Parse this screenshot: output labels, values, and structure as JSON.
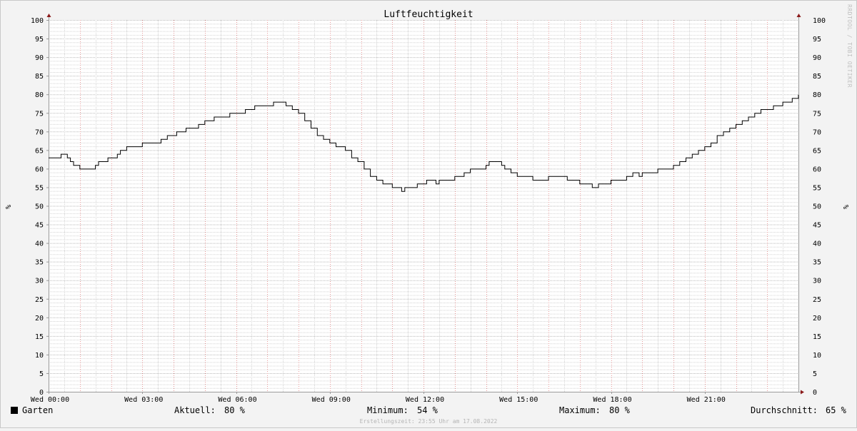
{
  "watermark": "RRDTOOL / TOBI OETIKER",
  "footer": "Erstellungszeit: 23:55 Uhr am 17.08.2022",
  "colors": {
    "background": "#f3f3f3",
    "canvas": "#ffffff",
    "minor_grid": "#d4d4d4",
    "major_grid": "#e89a9a",
    "axis": "#9a9a9a",
    "arrow": "#8b1a1a",
    "series": "#000000"
  },
  "legend": {
    "series_name": "Garten",
    "aktuell_label": "Aktuell:",
    "aktuell_value": "80 %",
    "minimum_label": "Minimum:",
    "minimum_value": "54 %",
    "maximum_label": "Maximum:",
    "maximum_value": "80 %",
    "durchschnitt_label": "Durchschnitt:",
    "durchschnitt_value": "65 %"
  },
  "chart_data": {
    "type": "line",
    "title": "Luftfeuchtigkeit",
    "ylabel": "%",
    "ylabel_right": "%",
    "ylim": [
      0,
      100
    ],
    "y_ticks": [
      0,
      5,
      10,
      15,
      20,
      25,
      30,
      35,
      40,
      45,
      50,
      55,
      60,
      65,
      70,
      75,
      80,
      85,
      90,
      95,
      100
    ],
    "xlim": [
      0,
      24
    ],
    "x_unit": "hours",
    "x_ticks": [
      {
        "x": 0,
        "label": "Wed 00:00"
      },
      {
        "x": 3,
        "label": "Wed 03:00"
      },
      {
        "x": 6,
        "label": "Wed 06:00"
      },
      {
        "x": 9,
        "label": "Wed 09:00"
      },
      {
        "x": 12,
        "label": "Wed 12:00"
      },
      {
        "x": 15,
        "label": "Wed 15:00"
      },
      {
        "x": 18,
        "label": "Wed 18:00"
      },
      {
        "x": 21,
        "label": "Wed 21:00"
      }
    ],
    "grid": true,
    "legend_position": "bottom",
    "series": [
      {
        "name": "Garten",
        "step": true,
        "x": [
          0,
          0.4,
          0.6,
          0.7,
          0.8,
          1.0,
          1.5,
          1.6,
          1.8,
          1.9,
          2.0,
          2.2,
          2.3,
          2.5,
          2.7,
          3.0,
          3.6,
          3.8,
          4.1,
          4.4,
          4.8,
          5.0,
          5.3,
          5.8,
          6.3,
          6.6,
          7.2,
          7.4,
          7.6,
          7.8,
          8.0,
          8.2,
          8.4,
          8.6,
          8.8,
          9.0,
          9.2,
          9.5,
          9.7,
          9.9,
          10.1,
          10.3,
          10.5,
          10.7,
          11.0,
          11.3,
          11.4,
          11.5,
          11.6,
          11.8,
          12.1,
          12.4,
          12.5,
          12.7,
          13.0,
          13.3,
          13.5,
          13.8,
          14.0,
          14.1,
          14.3,
          14.5,
          14.6,
          14.8,
          15.0,
          15.5,
          16.0,
          16.3,
          16.6,
          17.0,
          17.4,
          17.6,
          17.8,
          18.0,
          18.5,
          18.7,
          18.9,
          19.0,
          19.5,
          19.8,
          20.0,
          20.2,
          20.4,
          20.6,
          20.8,
          21.0,
          21.2,
          21.4,
          21.6,
          21.8,
          22.0,
          22.2,
          22.4,
          22.6,
          22.8,
          23.2,
          23.5,
          23.8,
          24.0
        ],
        "values": [
          63,
          64,
          63,
          62,
          61,
          60,
          61,
          62,
          62,
          63,
          63,
          64,
          65,
          66,
          66,
          67,
          68,
          69,
          70,
          71,
          72,
          73,
          74,
          75,
          76,
          77,
          78,
          78,
          77,
          76,
          75,
          73,
          71,
          69,
          68,
          67,
          66,
          65,
          63,
          62,
          60,
          58,
          57,
          56,
          55,
          54,
          55,
          55,
          55,
          56,
          57,
          56,
          57,
          57,
          58,
          59,
          60,
          60,
          61,
          62,
          62,
          61,
          60,
          59,
          58,
          57,
          58,
          58,
          57,
          56,
          55,
          56,
          56,
          57,
          58,
          59,
          58,
          59,
          60,
          60,
          61,
          62,
          63,
          64,
          65,
          66,
          67,
          69,
          70,
          71,
          72,
          73,
          74,
          75,
          76,
          77,
          78,
          79,
          80
        ]
      }
    ]
  }
}
